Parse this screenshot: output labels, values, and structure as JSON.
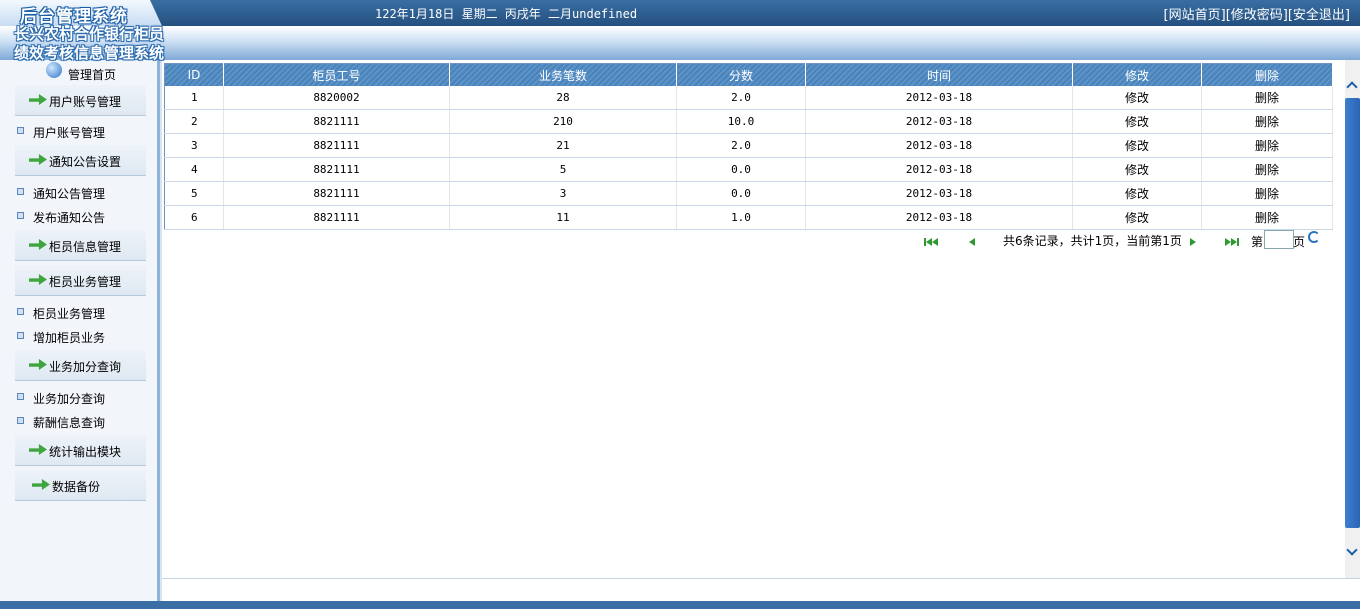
{
  "header": {
    "logo": "后台管理系统",
    "date": "122年1月18日 星期二 丙戌年 二月undefined",
    "links": [
      "[网站首页]",
      "[修改密码]",
      "[安全退出]"
    ]
  },
  "system_title": "长兴农村合作银行柜员绩效考核信息管理系统",
  "sidebar": {
    "home": "管理首页",
    "sections": [
      {
        "label": "用户账号管理",
        "items": [
          "用户账号管理"
        ]
      },
      {
        "label": "通知公告设置",
        "items": [
          "通知公告管理",
          "发布通知公告"
        ]
      },
      {
        "label": "柜员信息管理",
        "items": []
      },
      {
        "label": "柜员业务管理",
        "items": [
          "柜员业务管理",
          "增加柜员业务"
        ]
      },
      {
        "label": "业务加分查询",
        "items": [
          "业务加分查询",
          "薪酬信息查询"
        ]
      },
      {
        "label": "统计输出模块",
        "items": []
      },
      {
        "label": "数据备份",
        "items": []
      }
    ]
  },
  "table": {
    "columns": [
      "ID",
      "柜员工号",
      "业务笔数",
      "分数",
      "时间",
      "修改",
      "删除"
    ],
    "rows": [
      {
        "id": "1",
        "teller": "8820002",
        "count": "28",
        "score": "2.0",
        "date": "2012-03-18",
        "edit": "修改",
        "del": "删除"
      },
      {
        "id": "2",
        "teller": "8821111",
        "count": "210",
        "score": "10.0",
        "date": "2012-03-18",
        "edit": "修改",
        "del": "删除"
      },
      {
        "id": "3",
        "teller": "8821111",
        "count": "21",
        "score": "2.0",
        "date": "2012-03-18",
        "edit": "修改",
        "del": "删除"
      },
      {
        "id": "4",
        "teller": "8821111",
        "count": "5",
        "score": "0.0",
        "date": "2012-03-18",
        "edit": "修改",
        "del": "删除"
      },
      {
        "id": "5",
        "teller": "8821111",
        "count": "3",
        "score": "0.0",
        "date": "2012-03-18",
        "edit": "修改",
        "del": "删除"
      },
      {
        "id": "6",
        "teller": "8821111",
        "count": "11",
        "score": "1.0",
        "date": "2012-03-18",
        "edit": "修改",
        "del": "删除"
      }
    ]
  },
  "pager": {
    "info": "共6条记录，共计1页，当前第1页",
    "page_prefix": "第",
    "page_suffix": "页",
    "page_value": ""
  },
  "colors": {
    "topbar": "#24507f",
    "table_header": "#4a82ba",
    "nav_arrow": "#3fa63f",
    "scroll_thumb": "#2a64b5"
  }
}
